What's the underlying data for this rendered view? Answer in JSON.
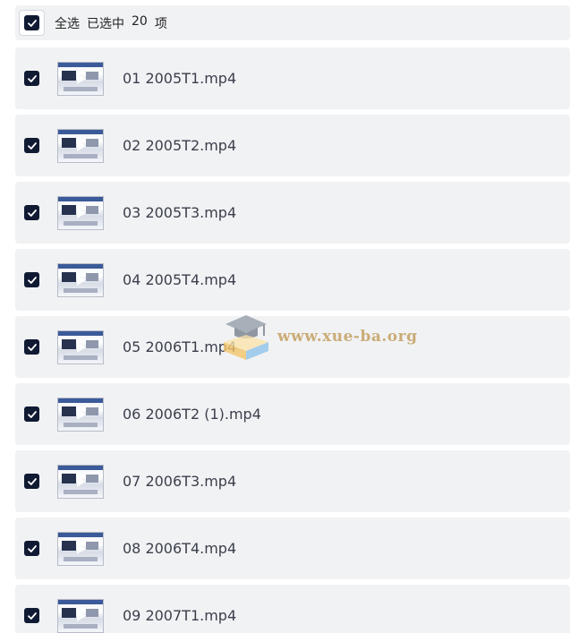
{
  "header": {
    "select_all_label": "全选",
    "selected_prefix": "已选中",
    "selected_count": "20",
    "selected_suffix": "项"
  },
  "files": [
    {
      "name": "01 2005T1.mp4",
      "checked": true
    },
    {
      "name": "02 2005T2.mp4",
      "checked": true
    },
    {
      "name": "03 2005T3.mp4",
      "checked": true
    },
    {
      "name": "04 2005T4.mp4",
      "checked": true
    },
    {
      "name": "05 2006T1.mp4",
      "checked": true
    },
    {
      "name": "06 2006T2 (1).mp4",
      "checked": true
    },
    {
      "name": "07 2006T3.mp4",
      "checked": true
    },
    {
      "name": "08 2006T4.mp4",
      "checked": true
    },
    {
      "name": "09 2007T1.mp4",
      "checked": true
    }
  ],
  "watermark": {
    "text": "www.xue-ba.org",
    "icon": "graduation-cap-book-icon"
  },
  "colors": {
    "checkbox": "#111a33",
    "row_background": "#f1f2f4",
    "watermark_text": "#c4a060"
  },
  "icons": {
    "checkbox": "checkmark-icon",
    "thumbnail_overlay": "play-icon"
  }
}
